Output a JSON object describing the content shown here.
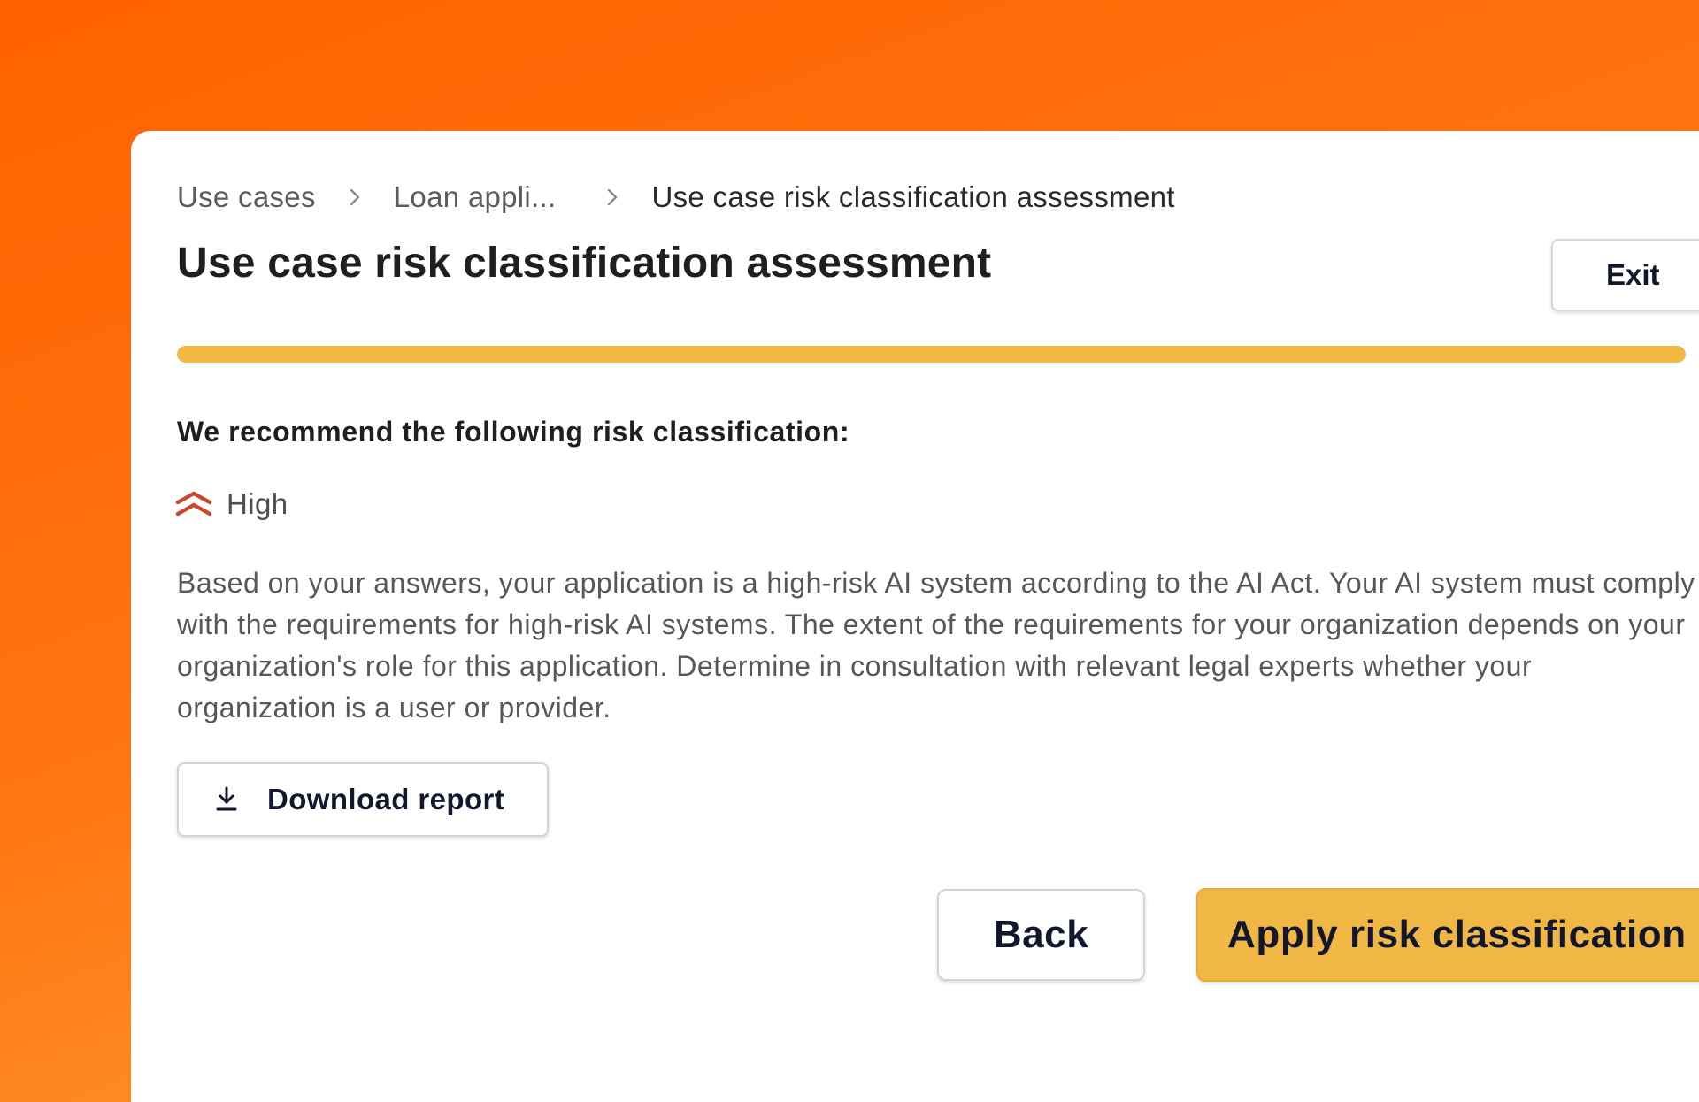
{
  "breadcrumb": {
    "items": [
      {
        "label": "Use cases"
      },
      {
        "label": "Loan appli..."
      },
      {
        "label": "Use case risk classification assessment"
      }
    ]
  },
  "header": {
    "title": "Use case risk classification assessment",
    "exit_label": "Exit"
  },
  "progress": {
    "percent": 100,
    "color": "#f2b945"
  },
  "recommendation": {
    "heading": "We recommend the following risk classification:",
    "risk_level": "High",
    "risk_icon": "double-chevron-up-icon",
    "risk_color": "#c9472c",
    "description": "Based on your answers, your application is a high-risk AI system according to the AI Act. Your AI system must comply with the requirements for high-risk AI systems. The extent of the requirements for your organization depends on your organization's role for this application. Determine in consultation with relevant legal experts whether your organization is a user or provider."
  },
  "actions": {
    "download_label": "Download report",
    "download_icon": "download-icon",
    "back_label": "Back",
    "apply_label": "Apply risk classification",
    "accent_color": "#f1b744"
  }
}
